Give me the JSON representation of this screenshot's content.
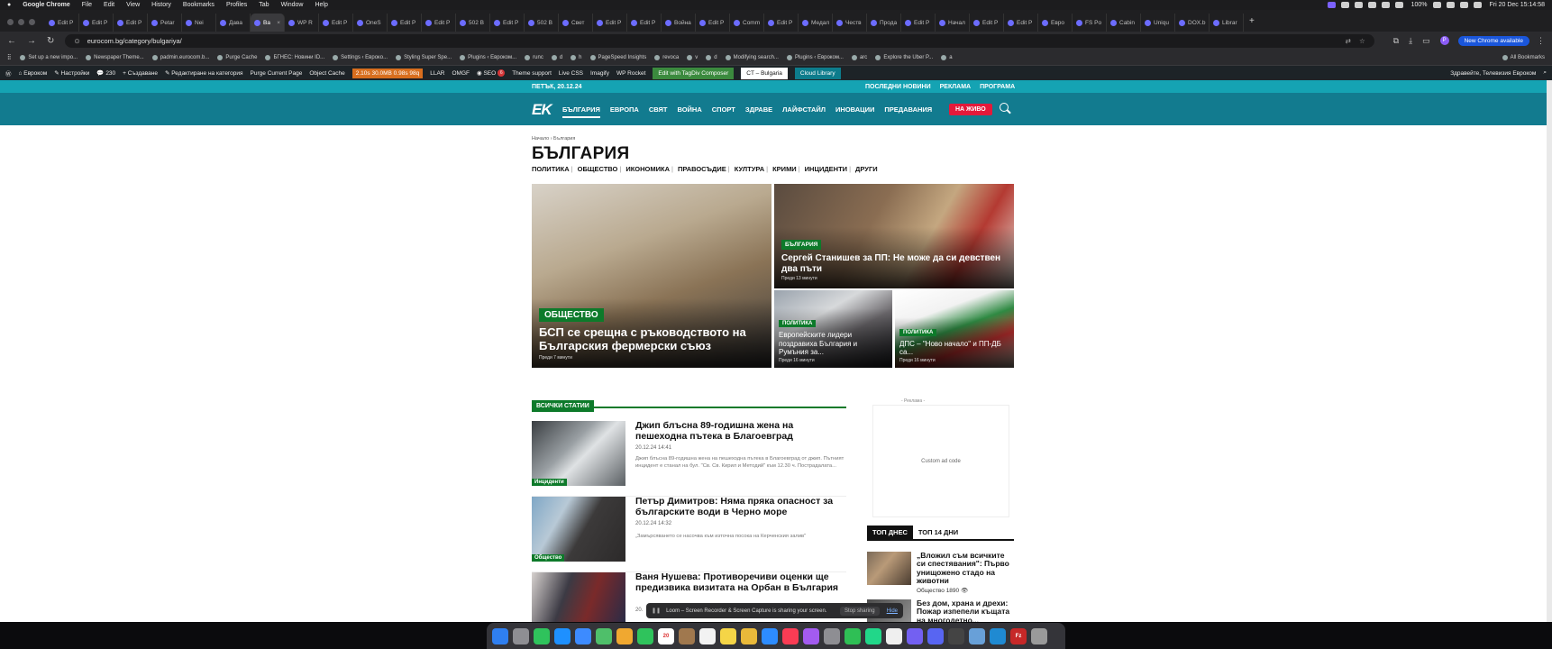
{
  "mac_menubar": {
    "app": "Google Chrome",
    "menus": [
      "File",
      "Edit",
      "View",
      "History",
      "Bookmarks",
      "Profiles",
      "Tab",
      "Window",
      "Help"
    ],
    "battery": "100%",
    "clock": "Fri 20 Dec 15:14:58"
  },
  "tabs": [
    "Edit P",
    "Edit P",
    "Edit P",
    "Petar",
    "Nei",
    "Дава",
    "Ва",
    "WP R",
    "Edit P",
    "OneS",
    "Edit P",
    "Edit P",
    "502 B",
    "Edit P",
    "502 B",
    "Свет",
    "Edit P",
    "Edit P",
    "Война",
    "Edit P",
    "Comm",
    "Edit P",
    "Медал",
    "Честв",
    "Прода",
    "Edit P",
    "Начал",
    "Edit P",
    "Edit P",
    "Евро",
    "FS Po",
    "Cabin",
    "Uniqu",
    "DOX.b",
    "Librar"
  ],
  "active_tab_index": 6,
  "address": {
    "url": "eurocom.bg/category/bulgariya/",
    "new_chrome": "New Chrome available",
    "profile_initial": "P"
  },
  "bookmarks": [
    "Set up a new impo...",
    "Newspaper Theme...",
    "padmin.eurocom.b...",
    "Purge Cache",
    "БГНЕС: Новини ID...",
    "Settings ‹ Евроко...",
    "Styling Super Spe...",
    "Plugins ‹ Евроком...",
    "runc",
    "d",
    "h",
    "PageSpeed Insights",
    "revoca",
    "v",
    "d",
    "Modifying search...",
    "Plugins ‹ Евроком...",
    "arc",
    "Explore the Uber P...",
    "a"
  ],
  "bookmarks_all": "All Bookmarks",
  "wp_bar": {
    "site": "Евроком",
    "customize": "Настройки",
    "comments": "230",
    "new": "Създаване",
    "edit_cat": "Редактиране на категория",
    "purge": "Purge Current Page",
    "object_cache": "Object Cache",
    "perf": "2.10s 30.0MB 0.98s 98q",
    "llar": "LLAR",
    "omgf": "OMGF",
    "seo": "SEO",
    "seo_count": "6",
    "theme_support": "Theme support",
    "live_css": "Live CSS",
    "imagify": "Imagify",
    "wp_rocket": "WP Rocket",
    "tagdiv": "Edit with TagDiv Composer",
    "ct": "CT – Bulgaria",
    "cloud": "Cloud Library",
    "greeting": "Здравейте, Телевизия Евроком"
  },
  "site": {
    "date": "ПЕТЪК, 20.12.24",
    "top_links": [
      "ПОСЛЕДНИ НОВИНИ",
      "РЕКЛАМА",
      "ПРОГРАМА"
    ],
    "logo": "EK",
    "nav": [
      "БЪЛГАРИЯ",
      "ЕВРОПА",
      "СВЯТ",
      "ВОЙНА",
      "СПОРТ",
      "ЗДРАВЕ",
      "ЛАЙФСТАЙЛ",
      "ИНОВАЦИИ",
      "ПРЕДАВАНИЯ"
    ],
    "live": "НА ЖИВО",
    "breadcrumb": "Начало › България",
    "title": "БЪЛГАРИЯ",
    "subcats": [
      "ПОЛИТИКА",
      "ОБЩЕСТВО",
      "ИКОНОМИКА",
      "ПРАВОСЪДИЕ",
      "КУЛТУРА",
      "КРИМИ",
      "ИНЦИДЕНТИ",
      "ДРУГИ"
    ],
    "hero": [
      {
        "badge": "ОБЩЕСТВО",
        "title": "БСП се срещна с ръководството на Българския фермерски съюз",
        "ago": "Преди 7 минути"
      },
      {
        "badge": "БЪЛГАРИЯ",
        "title": "Сергей Станишев за ПП: Не може да си девствен два пъти",
        "ago": "Преди 13 минути"
      },
      {
        "badge": "ПОЛИТИКА",
        "title": "Европейските лидери поздравиха България и Румъния за...",
        "ago": "Преди 16 минути"
      },
      {
        "badge": "ПОЛИТИКА",
        "title": "ДПС – \"Ново начало\" и ПП-ДБ са...",
        "ago": "Преди 16 минути"
      }
    ],
    "all_articles": "ВСИЧКИ СТАТИИ",
    "articles": [
      {
        "tag": "Инциденти",
        "title": "Джип блъсна 89-годишна жена на пешеходна пътека в Благоевград",
        "date": "20.12.24 14:41",
        "excerpt": "Джип блъсна 89-годишна жена на пешеходна пътека в Благоевград от джип. Пътният инцидент е станал на бул. \"Св. Св. Кирил и Методий\" към 12.30 ч. Пострадалата..."
      },
      {
        "tag": "Общество",
        "title": "Петър Димитров: Няма пряка опасност за българските води в Черно море",
        "date": "20.12.24 14:32",
        "excerpt": "„Замърсяването се насочва към източна посока на Керченския залив\""
      },
      {
        "tag": "",
        "title": "Ваня Нушева: Противоречиви оценки ще предизвика визитата на Орбан в България",
        "date": "20.",
        "excerpt": ""
      }
    ],
    "ad_label": "- Реклама -",
    "ad_text": "Custom ad code",
    "pop_tabs": [
      "ТОП ДНЕС",
      "ТОП 14 ДНИ"
    ],
    "popular": [
      {
        "title": "„Вложил съм всичките си спестявания\": Първо унищожено стадо на животни",
        "meta": "Общество  1890 👁"
      },
      {
        "title": "Без дом, храна и дрехи: Пожар изпепели къщата на многодетно...",
        "meta": ""
      }
    ]
  },
  "share_bar": {
    "text": "Loom – Screen Recorder & Screen Capture is sharing your screen.",
    "stop": "Stop sharing",
    "hide": "Hide"
  },
  "dock": [
    {
      "name": "finder",
      "color": "#2f7ff0"
    },
    {
      "name": "launchpad",
      "color": "#8e8e93"
    },
    {
      "name": "messages",
      "color": "#2fc35c"
    },
    {
      "name": "safari",
      "color": "#1e90ff"
    },
    {
      "name": "mail",
      "color": "#3d8bff"
    },
    {
      "name": "maps",
      "color": "#4fbf6a"
    },
    {
      "name": "photos",
      "color": "#f0a830"
    },
    {
      "name": "facetime",
      "color": "#2fc35c"
    },
    {
      "name": "calendar",
      "color": "#ffffff",
      "label": "20"
    },
    {
      "name": "contacts",
      "color": "#a0784e"
    },
    {
      "name": "reminders",
      "color": "#f2f2f2"
    },
    {
      "name": "notes",
      "color": "#f5d547"
    },
    {
      "name": "chrome",
      "color": "#e9b93a"
    },
    {
      "name": "appstore",
      "color": "#2d8cff"
    },
    {
      "name": "music",
      "color": "#fa3c54"
    },
    {
      "name": "podcasts",
      "color": "#a35bf0"
    },
    {
      "name": "settings",
      "color": "#8e8e93"
    },
    {
      "name": "numbers",
      "color": "#2fbf55"
    },
    {
      "name": "pycharm",
      "color": "#21d789"
    },
    {
      "name": "textedit",
      "color": "#efefef"
    },
    {
      "name": "viber",
      "color": "#7360f2"
    },
    {
      "name": "discord",
      "color": "#5865f2"
    },
    {
      "name": "calculator",
      "color": "#444"
    },
    {
      "name": "preview",
      "color": "#68a0d8"
    },
    {
      "name": "vscode",
      "color": "#1f8ad2"
    },
    {
      "name": "filezilla",
      "color": "#c62828",
      "label": "Fz"
    },
    {
      "name": "trash",
      "color": "#9a9a9a"
    }
  ]
}
